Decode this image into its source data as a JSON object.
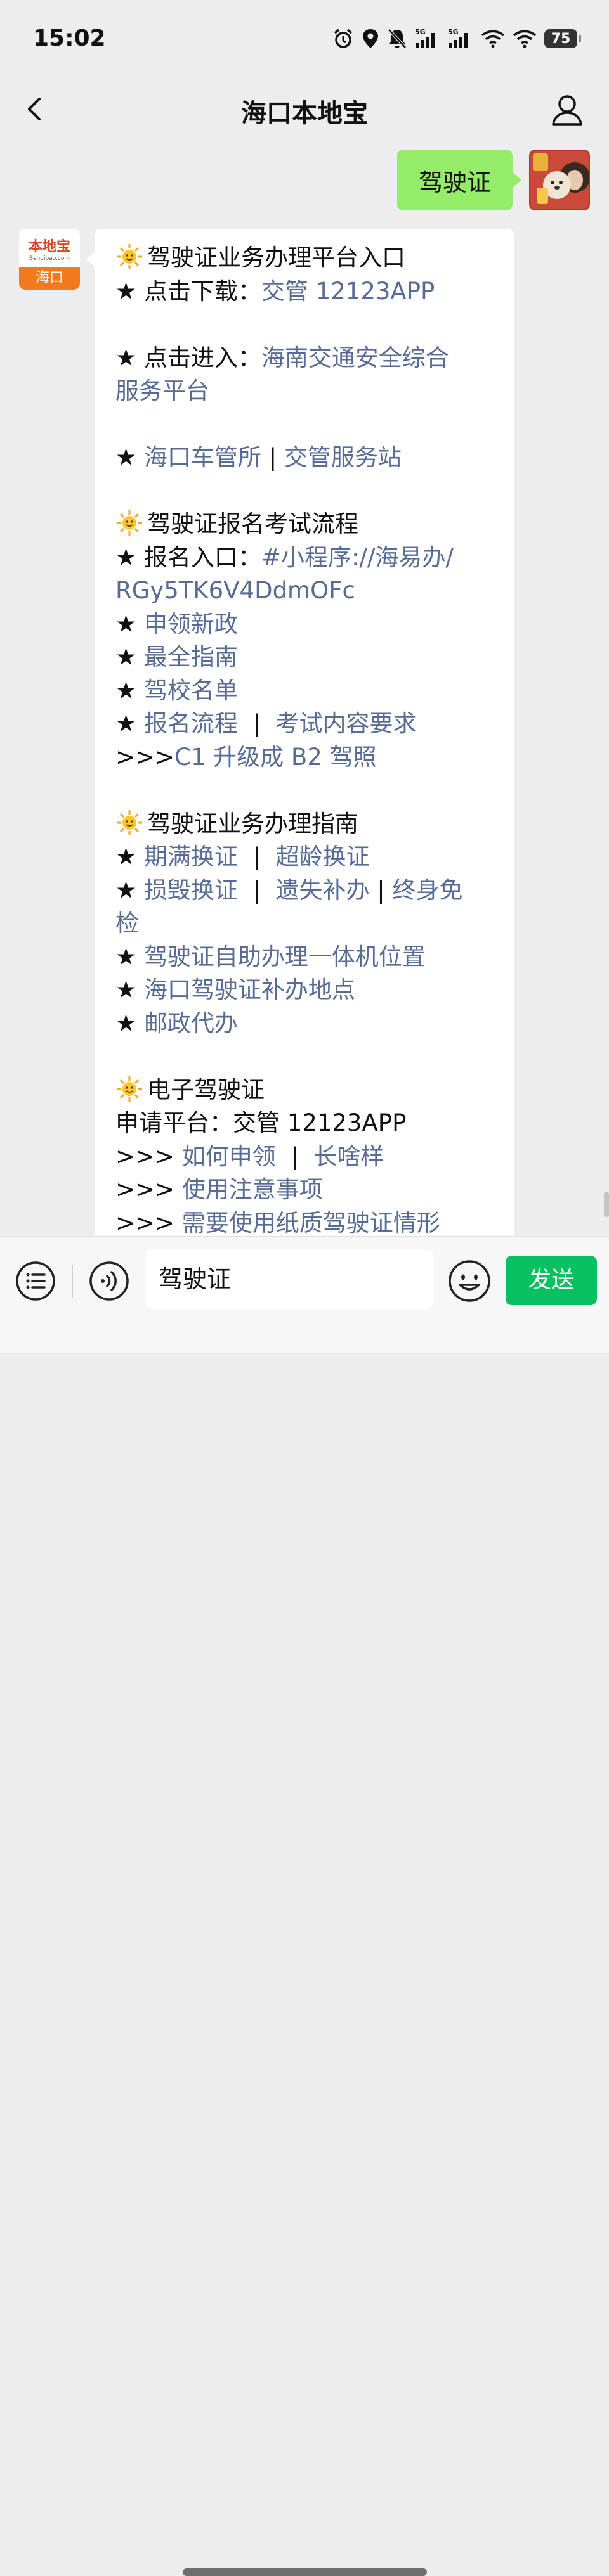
{
  "status_bar": {
    "time": "15:02",
    "battery": "75"
  },
  "nav": {
    "title": "海口本地宝"
  },
  "sent_message": "驾驶证",
  "bot_avatar": {
    "brand": "本地宝",
    "sub": "Bendibao.com",
    "city": "海口"
  },
  "bot_message": {
    "section1_title": "驾驶证业务办理平台入口",
    "download_prefix": "★ 点击下载：",
    "download_link": "交管 12123APP",
    "enter_prefix": "★ 点击进入：",
    "enter_link_1": "海南交通安全综合",
    "enter_link_2": "服务平台",
    "star": "★",
    "office_link": "海口车管所",
    "sep": "|",
    "station_link": "交管服务站",
    "section2_title": "驾驶证报名考试流程",
    "signup_prefix": "★ 报名入口：",
    "signup_link_1": "#小程序://海易办/",
    "signup_link_2": "RGy5TK6V4DdmOFc",
    "new_policy": "申领新政",
    "full_guide": "最全指南",
    "school_list": "驾校名单",
    "signup_flow": "报名流程",
    "exam_req": "考试内容要求",
    "arrow": ">>>",
    "upgrade": "C1 升级成 B2 驾照",
    "section3_title": "驾驶证业务办理指南",
    "expire_renew": "期满换证",
    "age_renew": "超龄换证",
    "damage_renew": "损毁换证",
    "lost_reissue": "遗失补办",
    "lifetime_1": "终身免",
    "lifetime_2": "检",
    "kiosk": "驾驶证自助办理一体机位置",
    "reissue_place": "海口驾驶证补办地点",
    "postal": "邮政代办",
    "section4_title": "电子驾驶证",
    "platform": "申请平台：交管 12123APP",
    "how_apply": "如何申领",
    "looks": "长啥样",
    "notes": "使用注意事项",
    "paper": "需要使用纸质驾驶证情形"
  },
  "input": {
    "value": "驾驶证",
    "send_label": "发送"
  },
  "icons": [
    "back-arrow-icon",
    "profile-icon",
    "alarm-icon",
    "location-icon",
    "mute-icon",
    "signal-icon",
    "wifi-icon",
    "sun-emoji-icon",
    "menu-list-icon",
    "voice-icon",
    "emoji-icon"
  ],
  "colors": {
    "link": "#576b95",
    "sent_bubble": "#95ec69",
    "send_button": "#07c160",
    "background": "#ededed"
  }
}
